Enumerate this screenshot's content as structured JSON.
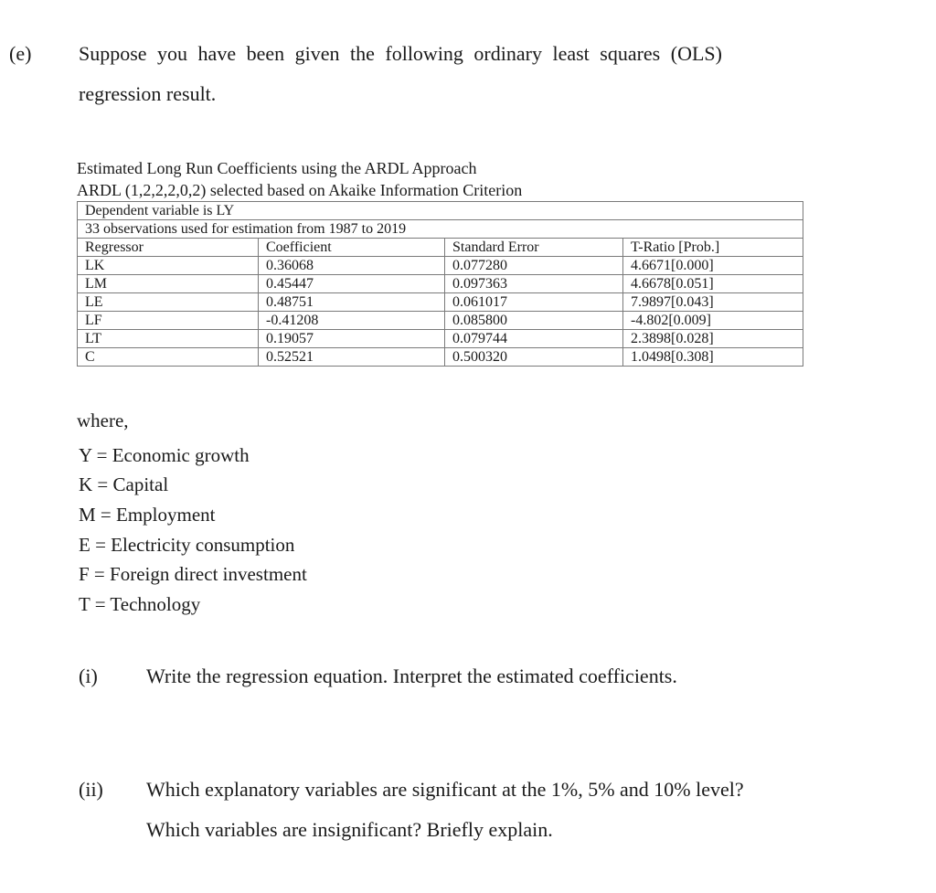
{
  "question": {
    "part_label": "(e)",
    "intro_line_1": "Suppose you have been given the following ordinary least squares (OLS)",
    "intro_line_2": "regression result."
  },
  "table_caption": {
    "line_1": "Estimated Long Run Coefficients using the ARDL Approach",
    "line_2": "ARDL (1,2,2,2,0,2) selected based on Akaike Information Criterion"
  },
  "regression_table": {
    "dependent_variable": "Dependent variable is LY",
    "observations": "33 observations used for estimation from 1987 to 2019",
    "headers": [
      "Regressor",
      "Coefficient",
      "Standard Error",
      "T-Ratio [Prob.]"
    ],
    "rows": [
      [
        "LK",
        "0.36068",
        "0.077280",
        "4.6671[0.000]"
      ],
      [
        "LM",
        "0.45447",
        "0.097363",
        "4.6678[0.051]"
      ],
      [
        "LE",
        "0.48751",
        "0.061017",
        "7.9897[0.043]"
      ],
      [
        "LF",
        "-0.41208",
        "0.085800",
        "-4.802[0.009]"
      ],
      [
        "LT",
        "0.19057",
        "0.079744",
        "2.3898[0.028]"
      ],
      [
        "C",
        "0.52521",
        "0.500320",
        "1.0498[0.308]"
      ]
    ]
  },
  "definitions": {
    "heading": "where,",
    "items": [
      "Y = Economic growth",
      "K = Capital",
      "M = Employment",
      "E = Electricity consumption",
      "F = Foreign direct investment",
      "T = Technology"
    ]
  },
  "sub_questions": [
    {
      "label": "(i)",
      "lines": [
        "Write the regression equation. Interpret the estimated coefficients."
      ]
    },
    {
      "label": "(ii)",
      "lines": [
        "Which explanatory variables are significant at the 1%, 5% and 10% level?",
        "Which variables are insignificant? Briefly explain."
      ]
    }
  ]
}
